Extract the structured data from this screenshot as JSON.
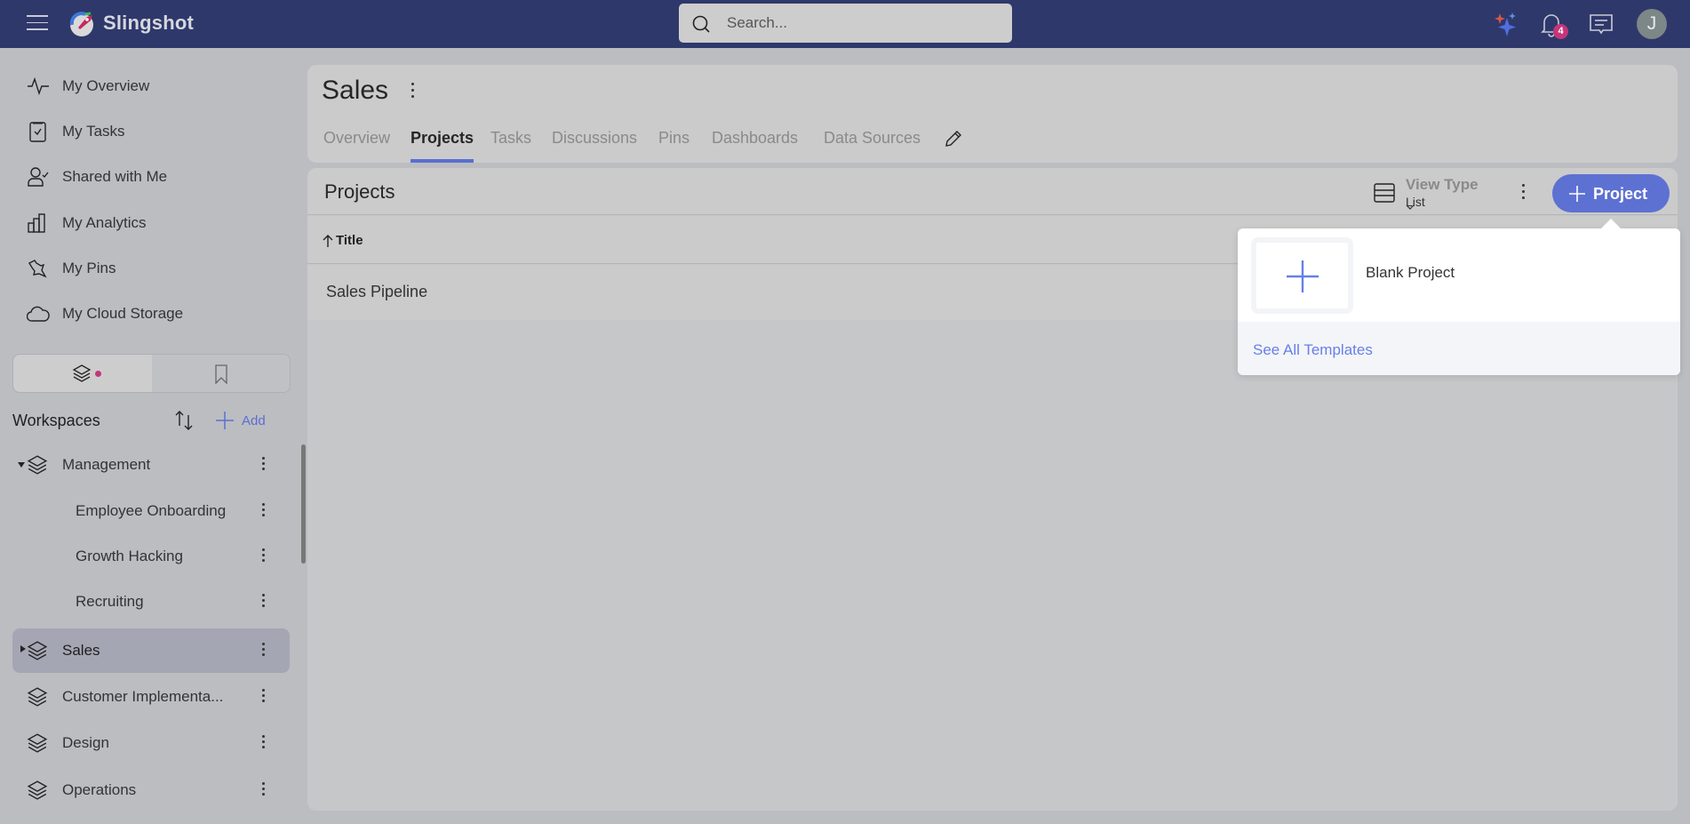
{
  "app": {
    "brand": "Slingshot",
    "colors": {
      "topbar": "#2f386b",
      "accent": "#5d71d2",
      "badge": "#c4367a",
      "link": "#6680e8"
    }
  },
  "topbar": {
    "menu_icon": "hamburger-icon",
    "logo_icon": "slingshot-rocket-logo",
    "search": {
      "placeholder": "Search...",
      "value": ""
    },
    "icons": [
      "sparkle-ai-icon",
      "bell-icon",
      "chat-icon"
    ],
    "notifications_count": "4",
    "avatar_initial": "J"
  },
  "sidebar": {
    "nav": [
      {
        "label": "My Overview",
        "icon": "activity-icon"
      },
      {
        "label": "My Tasks",
        "icon": "clipboard-check-icon"
      },
      {
        "label": "Shared with Me",
        "icon": "user-check-icon"
      },
      {
        "label": "My Analytics",
        "icon": "bar-chart-icon"
      },
      {
        "label": "My Pins",
        "icon": "pin-icon"
      },
      {
        "label": "My Cloud Storage",
        "icon": "cloud-icon"
      }
    ],
    "toggle": [
      {
        "icon": "layers-icon",
        "active": true,
        "has_dot": true
      },
      {
        "icon": "bookmark-icon",
        "active": false
      }
    ],
    "workspaces_title": "Workspaces",
    "add_label": "Add",
    "workspaces": [
      {
        "label": "Management",
        "expanded": true,
        "level": 0
      },
      {
        "label": "Employee Onboarding",
        "level": 1
      },
      {
        "label": "Growth Hacking",
        "level": 1
      },
      {
        "label": "Recruiting",
        "level": 1
      },
      {
        "label": "Sales",
        "expanded": false,
        "level": 0,
        "selected": true
      },
      {
        "label": "Customer Implementa...",
        "level": 0
      },
      {
        "label": "Design",
        "level": 0
      },
      {
        "label": "Operations",
        "level": 0
      }
    ]
  },
  "header": {
    "title": "Sales",
    "tabs": [
      {
        "label": "Overview",
        "active": false
      },
      {
        "label": "Projects",
        "active": true
      },
      {
        "label": "Tasks",
        "active": false
      },
      {
        "label": "Discussions",
        "active": false
      },
      {
        "label": "Pins",
        "active": false
      },
      {
        "label": "Dashboards",
        "active": false
      },
      {
        "label": "Data Sources",
        "active": false
      }
    ]
  },
  "projects": {
    "title": "Projects",
    "view_type_label": "View Type",
    "view_type_value": "List",
    "new_button_label": "Project",
    "columns": [
      {
        "label": "Title",
        "sort": "ascending"
      }
    ],
    "rows": [
      {
        "title": "Sales Pipeline"
      }
    ]
  },
  "popup": {
    "blank_label": "Blank Project",
    "see_all_label": "See All Templates"
  }
}
